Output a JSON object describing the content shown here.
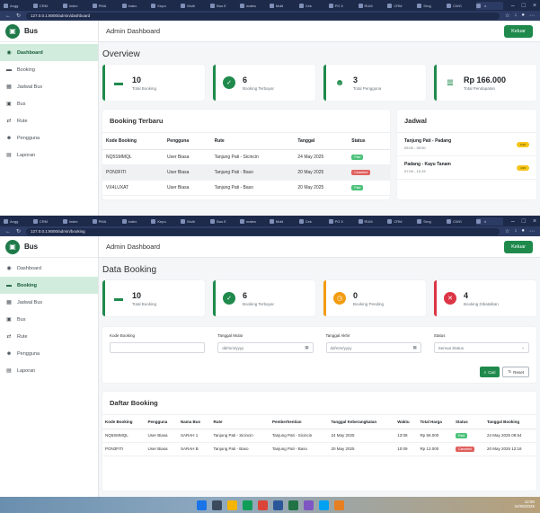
{
  "browser": {
    "tabs": [
      "Angg",
      "CRM",
      "Index",
      "PMA",
      "Index",
      "Kepo",
      "Multi",
      "Bus E",
      "mates",
      "Multi",
      "Cek",
      "PG 5",
      "RUM",
      "CRM",
      "Srng",
      "CWG"
    ],
    "active_tab": "",
    "url_dashboard": "127.0.0.1:8000/admin/dashboard",
    "url_booking": "127.0.0.1:8000/admin/booking"
  },
  "sidebar": {
    "brand": "Bus",
    "items": [
      {
        "label": "Dashboard",
        "icon": "speedometer-icon"
      },
      {
        "label": "Booking",
        "icon": "ticket-icon"
      },
      {
        "label": "Jadwal Bus",
        "icon": "calendar-icon"
      },
      {
        "label": "Bus",
        "icon": "bus-icon"
      },
      {
        "label": "Rute",
        "icon": "route-icon"
      },
      {
        "label": "Pengguna",
        "icon": "users-icon"
      },
      {
        "label": "Laporan",
        "icon": "report-icon"
      }
    ]
  },
  "header": {
    "title": "Admin Dashboard",
    "logout": "Keluar"
  },
  "overview": {
    "title": "Overview",
    "stats": [
      {
        "value": "10",
        "label": "Total Booking"
      },
      {
        "value": "6",
        "label": "Booking Terbayar"
      },
      {
        "value": "3",
        "label": "Total Pengguna"
      },
      {
        "value": "Rp 166.000",
        "label": "Total Pendapatan"
      }
    ],
    "booking_terbaru": {
      "title": "Booking Terbaru",
      "headers": [
        "Kode Booking",
        "Pengguna",
        "Rute",
        "Tanggal",
        "Status"
      ],
      "rows": [
        [
          "NQ5SMMQL",
          "User Biasa",
          "Tanjung Pati - Sicincin",
          "24 May 2025",
          "Paid"
        ],
        [
          "PON3FITI",
          "User Biasa",
          "Tanjung Pati - Baso",
          "20 May 2025",
          "Canceled"
        ],
        [
          "VX4LUXAT",
          "User Biasa",
          "Tanjung Pati - Baso",
          "20 May 2025",
          "Paid"
        ]
      ]
    },
    "jadwal": {
      "title": "Jadwal",
      "items": [
        {
          "route": "Tanjung Pati - Padang",
          "time": "05:00 - 09:00",
          "badge": "8/18"
        },
        {
          "route": "Padang - Kayu Tanam",
          "time": "07:00 - 10:15",
          "badge": "4/18"
        }
      ]
    }
  },
  "data_booking": {
    "title": "Data Booking",
    "stats": [
      {
        "value": "10",
        "label": "Total Booking"
      },
      {
        "value": "6",
        "label": "Booking Terbayar"
      },
      {
        "value": "0",
        "label": "Booking Pending"
      },
      {
        "value": "4",
        "label": "Booking Dibatalkan"
      }
    ],
    "filter": {
      "kode_label": "Kode Booking",
      "mulai_label": "Tanggal Mulai",
      "mulai_placeholder": "dd/mm/yyyy",
      "akhir_label": "Tanggal Akhir",
      "akhir_placeholder": "dd/mm/yyyy",
      "status_label": "Status",
      "status_value": "Semua Status",
      "cari": "Cari",
      "reset": "Reset"
    },
    "daftar": {
      "title": "Daftar Booking",
      "headers": [
        "Kode Booking",
        "Pengguna",
        "Nama Bus",
        "Rute",
        "Pemberhentian",
        "Tanggal Keberangkatan",
        "Waktu",
        "Total Harga",
        "Status",
        "Tanggal Booking"
      ],
      "rows": [
        [
          "NQ5SMMQL",
          "User Biasa",
          "SARAH 1",
          "Tanjung Pati - Sicincin",
          "Tanjung Pati - Sicincin",
          "24 May 2025",
          "13:08",
          "Rp 56.000",
          "Paid",
          "24 May 2025 08:54"
        ],
        [
          "PON3FITI",
          "User Biasa",
          "SARAH B",
          "Tanjung Pati - Baso",
          "Tanjung Pati - Baso",
          "20 May 2025",
          "10:09",
          "Rp 13.000",
          "Canceled",
          "20 May 2025 12:18"
        ]
      ]
    }
  },
  "taskbar": {
    "time": "12:50",
    "date": "24/05/2025"
  },
  "colors": {
    "brand": "#1f8a4c",
    "paid": "#4cc27a",
    "canceled": "#e0605e",
    "pending": "#f39c12",
    "cancel_stat": "#dc3545"
  }
}
